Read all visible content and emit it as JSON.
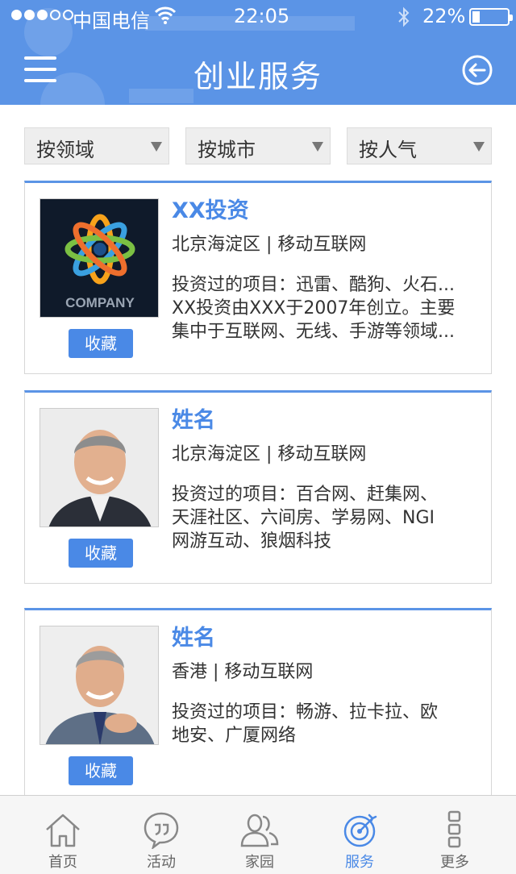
{
  "status_bar": {
    "carrier": "中国电信",
    "time": "22:05",
    "battery_percent": "22%",
    "battery_level": 0.22,
    "signal_bars_filled": 3,
    "signal_bars_total": 5
  },
  "header": {
    "title": "创业服务",
    "menu_icon": "hamburger-icon",
    "back_icon": "back-circle-icon",
    "color": "#5b94e6"
  },
  "filters": [
    {
      "label": "按领域"
    },
    {
      "label": "按城市"
    },
    {
      "label": "按人气"
    }
  ],
  "cards": [
    {
      "name": "XX投资",
      "location": "北京海淀区 | 移动互联网",
      "desc": [
        "投资过的项目：迅雷、酷狗、火石...",
        "XX投资由XXX于2007年创立。主要",
        "集中于互联网、无线、手游等领域..."
      ],
      "fav_label": "收藏",
      "logo_text": "COMPANY"
    },
    {
      "name": "姓名",
      "location": "北京海淀区 | 移动互联网",
      "desc": [
        "投资过的项目：百合网、赶集网、",
        "天涯社区、六间房、学易网、NGI",
        "网游互动、狼烟科技"
      ],
      "fav_label": "收藏"
    },
    {
      "name": "姓名",
      "location": "香港 | 移动互联网",
      "desc": [
        "投资过的项目：畅游、拉卡拉、欧",
        "地安、广厦网络"
      ],
      "fav_label": "收藏"
    }
  ],
  "tabbar": {
    "items": [
      {
        "label": "首页",
        "icon": "home-icon"
      },
      {
        "label": "活动",
        "icon": "quote-bubble-icon"
      },
      {
        "label": "家园",
        "icon": "people-icon"
      },
      {
        "label": "服务",
        "icon": "target-icon",
        "active": true
      },
      {
        "label": "更多",
        "icon": "more-icon"
      }
    ],
    "active_color": "#4a89e6"
  }
}
